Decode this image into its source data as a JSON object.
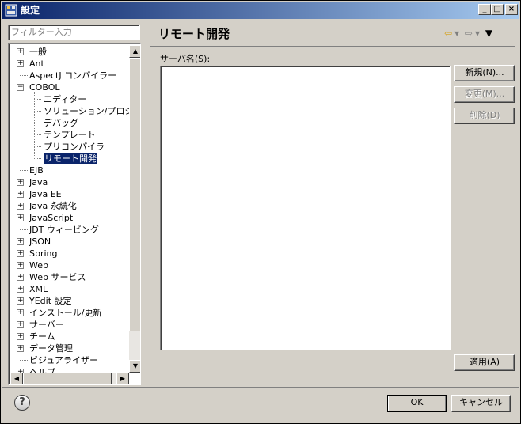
{
  "window": {
    "title": "設定"
  },
  "filter": {
    "placeholder": "フィルター入力"
  },
  "tree": {
    "items": [
      {
        "label": "一般",
        "level": 0,
        "expander": "+"
      },
      {
        "label": "Ant",
        "level": 0,
        "expander": "+"
      },
      {
        "label": "AspectJ コンパイラー",
        "level": 0,
        "expander": ""
      },
      {
        "label": "COBOL",
        "level": 0,
        "expander": "-"
      },
      {
        "label": "エディター",
        "level": 1,
        "expander": ""
      },
      {
        "label": "ソリューション/プロジェクト",
        "level": 1,
        "expander": ""
      },
      {
        "label": "デバッグ",
        "level": 1,
        "expander": ""
      },
      {
        "label": "テンプレート",
        "level": 1,
        "expander": ""
      },
      {
        "label": "プリコンパイラ",
        "level": 1,
        "expander": ""
      },
      {
        "label": "リモート開発",
        "level": 1,
        "expander": "",
        "selected": true
      },
      {
        "label": "EJB",
        "level": 0,
        "expander": ""
      },
      {
        "label": "Java",
        "level": 0,
        "expander": "+"
      },
      {
        "label": "Java EE",
        "level": 0,
        "expander": "+"
      },
      {
        "label": "Java 永続化",
        "level": 0,
        "expander": "+"
      },
      {
        "label": "JavaScript",
        "level": 0,
        "expander": "+"
      },
      {
        "label": "JDT ウィービング",
        "level": 0,
        "expander": ""
      },
      {
        "label": "JSON",
        "level": 0,
        "expander": "+"
      },
      {
        "label": "Spring",
        "level": 0,
        "expander": "+"
      },
      {
        "label": "Web",
        "level": 0,
        "expander": "+"
      },
      {
        "label": "Web サービス",
        "level": 0,
        "expander": "+"
      },
      {
        "label": "XML",
        "level": 0,
        "expander": "+"
      },
      {
        "label": "YEdit 設定",
        "level": 0,
        "expander": "+"
      },
      {
        "label": "インストール/更新",
        "level": 0,
        "expander": "+"
      },
      {
        "label": "サーバー",
        "level": 0,
        "expander": "+"
      },
      {
        "label": "チーム",
        "level": 0,
        "expander": "+"
      },
      {
        "label": "データ管理",
        "level": 0,
        "expander": "+"
      },
      {
        "label": "ビジュアライザー",
        "level": 0,
        "expander": ""
      },
      {
        "label": "ヘルプ",
        "level": 0,
        "expander": "+"
      }
    ]
  },
  "page": {
    "title": "リモート開発"
  },
  "servers": {
    "label": "サーバ名(S):"
  },
  "buttons": {
    "new": "新規(N)...",
    "edit": "変更(M)...",
    "delete": "削除(D)",
    "apply": "適用(A)",
    "ok": "OK",
    "cancel": "キャンセル"
  },
  "icons": {
    "back": "arrow-left-icon",
    "forward": "arrow-right-icon",
    "menu": "view-menu-icon",
    "help": "help-icon"
  },
  "colors": {
    "title_start": "#0a246a",
    "title_end": "#a6caf0",
    "selection": "#0a246a"
  }
}
